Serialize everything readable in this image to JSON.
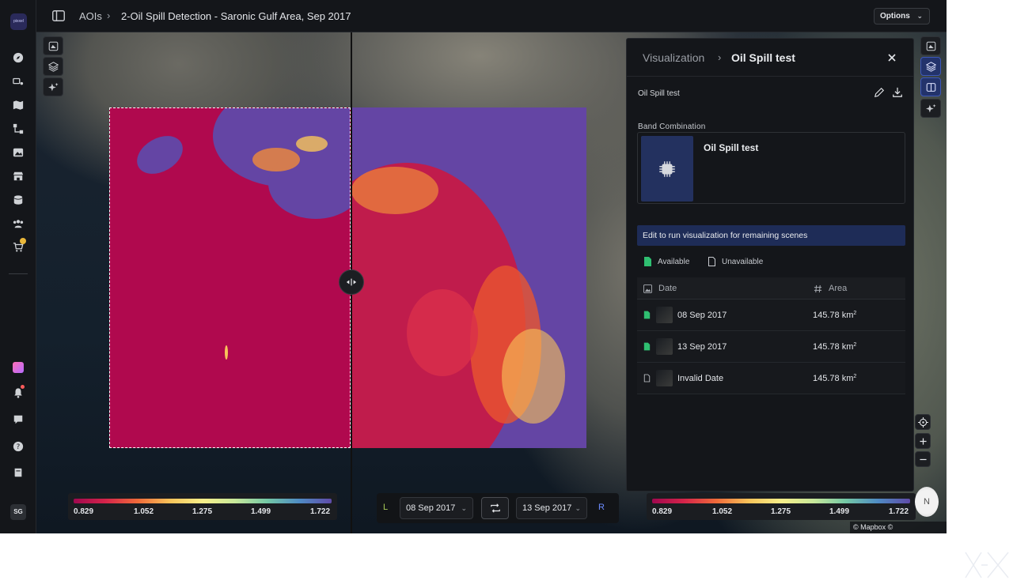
{
  "app": {
    "logo_text": "pixxel"
  },
  "header": {
    "breadcrumb_root": "AOIs",
    "breadcrumb_separator": "›",
    "breadcrumb_current": "2-Oil Spill Detection - Saronic Gulf Area, Sep 2017",
    "options_label": "Options"
  },
  "sidebar": {
    "cart_badge": "",
    "avatar_initials": "SG",
    "icons": [
      "compass-icon",
      "satellite-icon",
      "map-icon",
      "workflow-icon",
      "image-icon",
      "store-icon",
      "storage-icon",
      "team-icon",
      "cart-icon",
      "app-icon",
      "notification-icon",
      "chat-icon",
      "help-icon",
      "docs-icon"
    ]
  },
  "legend_left": {
    "ticks": [
      "0.829",
      "1.052",
      "1.275",
      "1.499",
      "1.722"
    ]
  },
  "legend_right": {
    "ticks": [
      "0.829",
      "1.052",
      "1.275",
      "1.499",
      "1.722"
    ]
  },
  "compare": {
    "left_tag": "L",
    "right_tag": "R",
    "left_date": "08 Sep 2017",
    "right_date": "13 Sep 2017"
  },
  "compass_label": "N",
  "attribution": "© Mapbox © OpenStreetMap",
  "panel": {
    "breadcrumb_parent": "Visualization",
    "breadcrumb_separator": "›",
    "title": "Oil Spill test",
    "visualization_name": "Oil Spill test",
    "band_combination_label": "Band Combination",
    "band_combination_name": "Oil Spill test",
    "notice": "Edit to run visualization for remaining scenes",
    "legend_available": "Available",
    "legend_unavailable": "Unavailable",
    "table": {
      "col_date": "Date",
      "col_area": "Area",
      "rows": [
        {
          "date": "08 Sep 2017",
          "area": "145.78 km",
          "unit_sup": "2",
          "available": true
        },
        {
          "date": "13 Sep 2017",
          "area": "145.78 km",
          "unit_sup": "2",
          "available": true
        },
        {
          "date": "Invalid Date",
          "area": "145.78 km",
          "unit_sup": "2",
          "available": false
        }
      ]
    }
  },
  "colors": {
    "accent": "#3c57b8",
    "available": "#2fbf71",
    "notice_bg": "#1e2c57",
    "oil_low": "#b0094e",
    "oil_high": "#6445a4"
  }
}
